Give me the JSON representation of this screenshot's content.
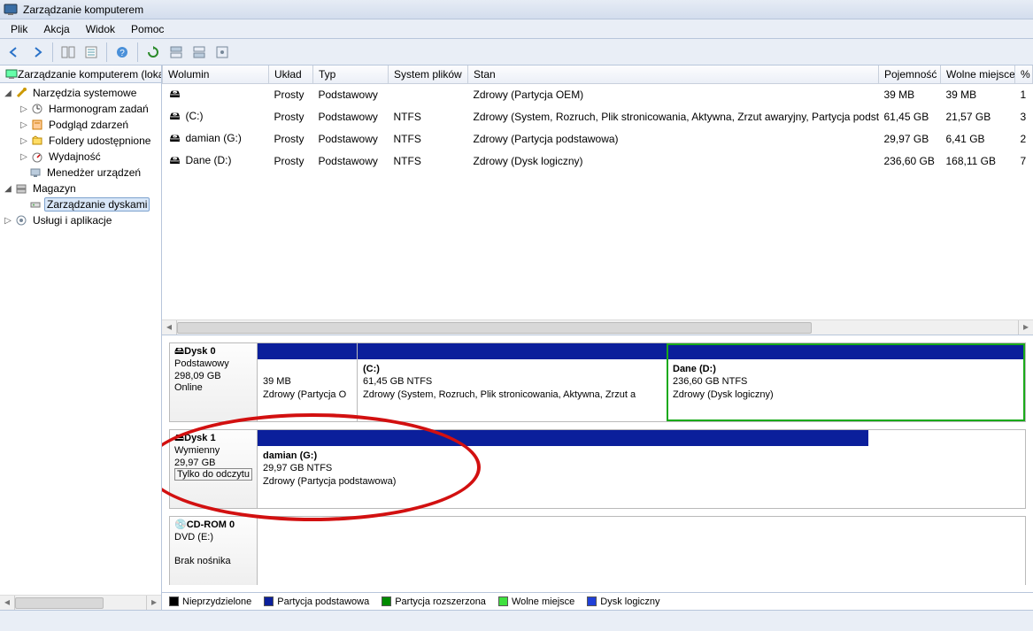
{
  "window": {
    "title": "Zarządzanie komputerem"
  },
  "menu": {
    "plik": "Plik",
    "akcja": "Akcja",
    "widok": "Widok",
    "pomoc": "Pomoc"
  },
  "tree": {
    "root": "Zarządzanie komputerem (loka",
    "narzedzia": "Narzędzia systemowe",
    "harmonogram": "Harmonogram zadań",
    "podglad": "Podgląd zdarzeń",
    "foldery": "Foldery udostępnione",
    "wydajnosc": "Wydajność",
    "menedzer": "Menedżer urządzeń",
    "magazyn": "Magazyn",
    "zdyskami": "Zarządzanie dyskami",
    "uslugi": "Usługi i aplikacje"
  },
  "columns": {
    "wolumin": "Wolumin",
    "uklad": "Układ",
    "typ": "Typ",
    "system": "System plików",
    "stan": "Stan",
    "pojemnosc": "Pojemność",
    "wolne": "Wolne miejsce",
    "pct": "%"
  },
  "volumes": [
    {
      "name": "",
      "layout": "Prosty",
      "type": "Podstawowy",
      "fs": "",
      "status": "Zdrowy (Partycja OEM)",
      "cap": "39 MB",
      "free": "39 MB",
      "pct": "1"
    },
    {
      "name": "(C:)",
      "layout": "Prosty",
      "type": "Podstawowy",
      "fs": "NTFS",
      "status": "Zdrowy (System, Rozruch, Plik stronicowania, Aktywna, Zrzut awaryjny, Partycja podstawowa)",
      "cap": "61,45 GB",
      "free": "21,57 GB",
      "pct": "3"
    },
    {
      "name": "damian (G:)",
      "layout": "Prosty",
      "type": "Podstawowy",
      "fs": "NTFS",
      "status": "Zdrowy (Partycja podstawowa)",
      "cap": "29,97 GB",
      "free": "6,41 GB",
      "pct": "2"
    },
    {
      "name": "Dane (D:)",
      "layout": "Prosty",
      "type": "Podstawowy",
      "fs": "NTFS",
      "status": "Zdrowy (Dysk logiczny)",
      "cap": "236,60 GB",
      "free": "168,11 GB",
      "pct": "7"
    }
  ],
  "disks": {
    "d0": {
      "title": "Dysk 0",
      "type": "Podstawowy",
      "size": "298,09 GB",
      "status": "Online",
      "p0": {
        "line1": "",
        "line2": "39 MB",
        "line3": "Zdrowy (Partycja O"
      },
      "p1": {
        "line1": "(C:)",
        "line2": "61,45 GB NTFS",
        "line3": "Zdrowy (System, Rozruch, Plik stronicowania, Aktywna, Zrzut a"
      },
      "p2": {
        "line1": "Dane  (D:)",
        "line2": "236,60 GB NTFS",
        "line3": "Zdrowy (Dysk logiczny)"
      }
    },
    "d1": {
      "title": "Dysk 1",
      "type": "Wymienny",
      "size": "29,97 GB",
      "status": "Tylko do odczytu",
      "p0": {
        "line1": "damian  (G:)",
        "line2": "29,97 GB NTFS",
        "line3": "Zdrowy (Partycja podstawowa)"
      }
    },
    "cd": {
      "title": "CD-ROM 0",
      "type": "DVD (E:)",
      "status": "Brak nośnika"
    }
  },
  "legend": {
    "nieprzy": "Nieprzydzielone",
    "podst": "Partycja podstawowa",
    "rozsz": "Partycja rozszerzona",
    "wolne": "Wolne miejsce",
    "log": "Dysk logiczny"
  }
}
